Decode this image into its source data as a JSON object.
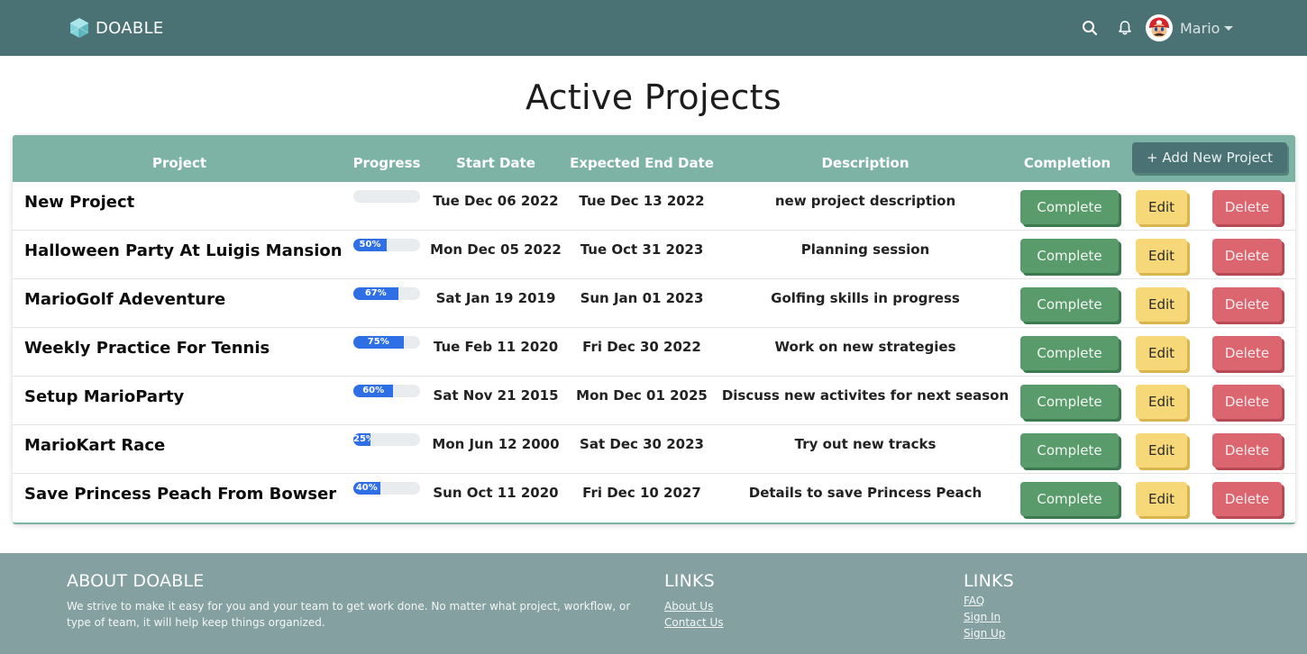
{
  "navbar": {
    "brand": "DOABLE",
    "icons": {
      "logo": "cube-logo-icon",
      "search": "search-icon",
      "notifications": "bell-icon"
    },
    "user": {
      "name": "Mario",
      "avatar": "mario-avatar"
    },
    "colors": {
      "background": "#4a7173",
      "logo": "#7fd3d9"
    }
  },
  "page": {
    "title": "Active Projects"
  },
  "table": {
    "headers": {
      "project": "Project",
      "progress": "Progress",
      "start": "Start Date",
      "end": "Expected End Date",
      "description": "Description",
      "completion": "Completion"
    },
    "add_button": {
      "icon": "plus-icon",
      "label": "+ Add New Project"
    },
    "buttons": {
      "complete": "Complete",
      "edit": "Edit",
      "delete": "Delete"
    },
    "rows": [
      {
        "name": "New Project",
        "progress": 0,
        "progress_label": "",
        "start": "Tue Dec 06 2022",
        "end": "Tue Dec 13 2022",
        "description": "new project description"
      },
      {
        "name": "Halloween Party At Luigis Mansion",
        "progress": 50,
        "progress_label": "50%",
        "start": "Mon Dec 05 2022",
        "end": "Tue Oct 31 2023",
        "description": "Planning session"
      },
      {
        "name": "MarioGolf Adeventure",
        "progress": 67,
        "progress_label": "67%",
        "start": "Sat Jan 19 2019",
        "end": "Sun Jan 01 2023",
        "description": "Golfing skills in progress"
      },
      {
        "name": "Weekly Practice For Tennis",
        "progress": 75,
        "progress_label": "75%",
        "start": "Tue Feb 11 2020",
        "end": "Fri Dec 30 2022",
        "description": "Work on new strategies"
      },
      {
        "name": "Setup MarioParty",
        "progress": 60,
        "progress_label": "60%",
        "start": "Sat Nov 21 2015",
        "end": "Mon Dec 01 2025",
        "description": "Discuss new activites for next season"
      },
      {
        "name": "MarioKart Race",
        "progress": 25,
        "progress_label": "25%",
        "start": "Mon Jun 12 2000",
        "end": "Sat Dec 30 2023",
        "description": "Try out new tracks"
      },
      {
        "name": "Save Princess Peach From Bowser",
        "progress": 40,
        "progress_label": "40%",
        "start": "Sun Oct 11 2020",
        "end": "Fri Dec 10 2027",
        "description": "Details to save Princess Peach"
      }
    ],
    "colors": {
      "header": "#7db3a5",
      "progress": "#2e6fe6",
      "complete": "#5a9b6c",
      "edit": "#f7d878",
      "delete": "#dc6670"
    }
  },
  "footer": {
    "about": {
      "heading": "ABOUT DOABLE",
      "text": "We strive to make it easy for you and your team to get work done. No matter what project, workflow, or type of team, it will help keep things organized."
    },
    "links1": {
      "heading": "LINKS",
      "items": [
        "About Us",
        "Contact Us"
      ]
    },
    "links2": {
      "heading": "LINKS",
      "items": [
        "FAQ",
        "Sign In",
        "Sign Up"
      ]
    },
    "colors": {
      "background": "#84a0a0"
    }
  }
}
